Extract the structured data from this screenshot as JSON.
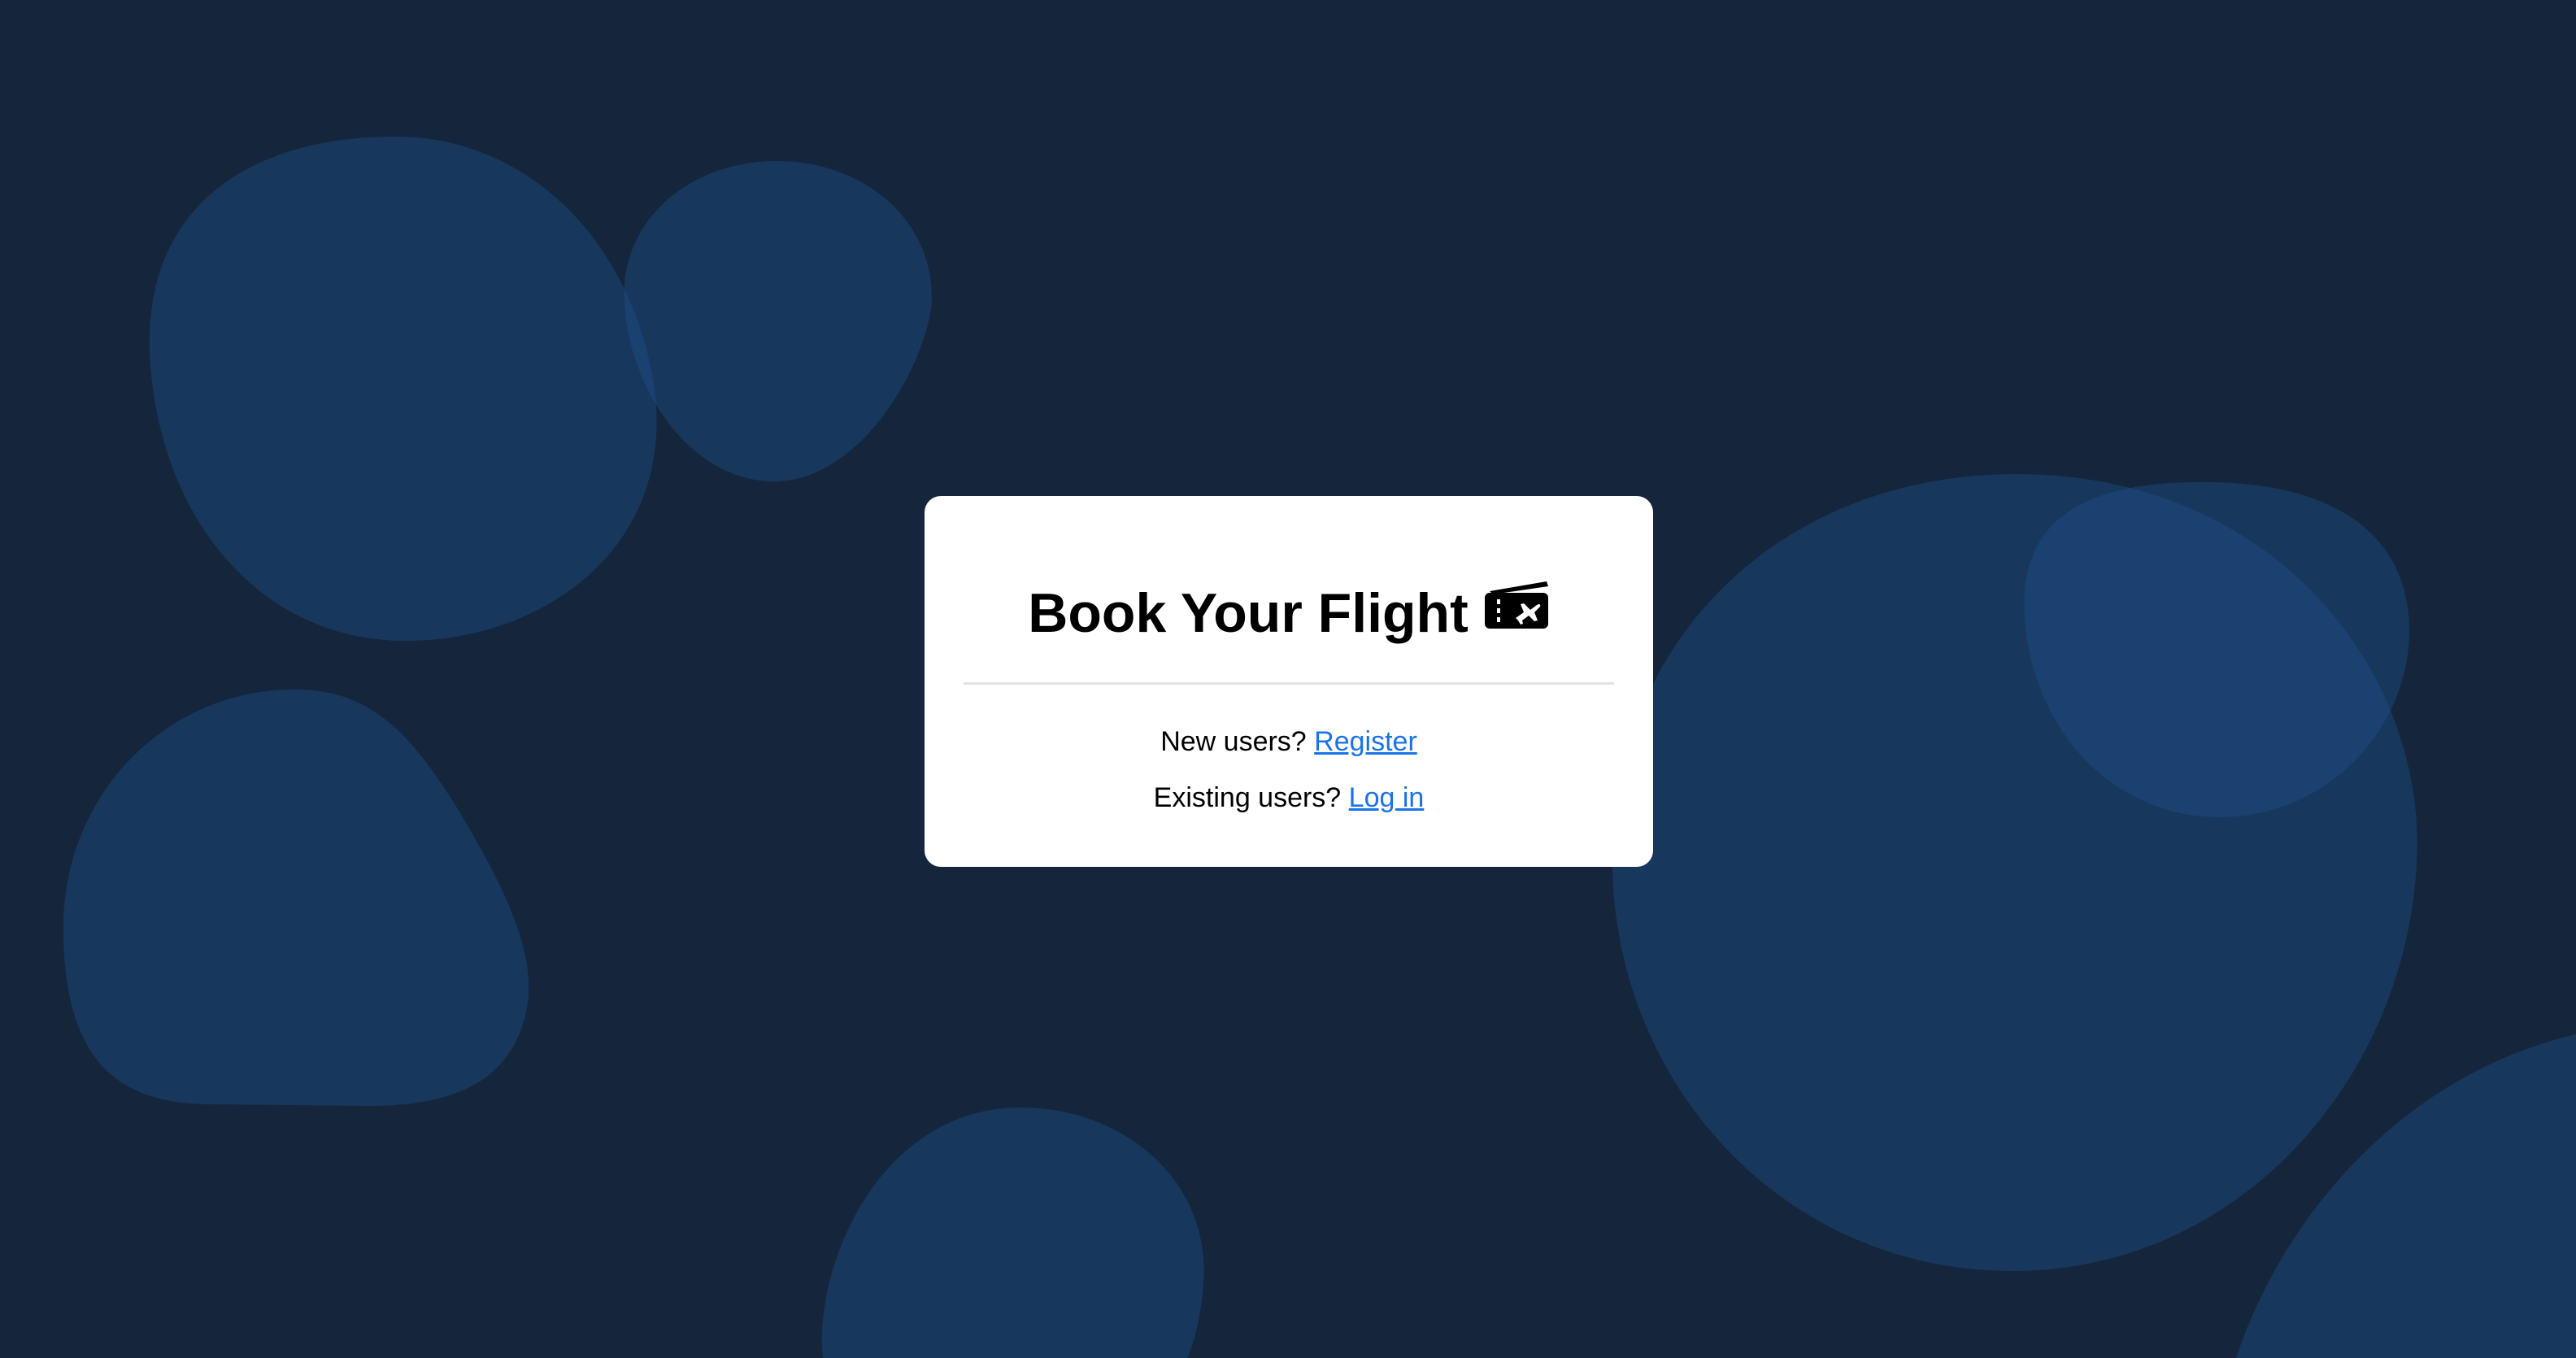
{
  "card": {
    "title": "Book Your Flight",
    "title_icon": "ticket-plane-icon",
    "new_users_text": "New users?",
    "register_link": "Register",
    "existing_users_text": "Existing users?",
    "login_link": "Log in"
  },
  "colors": {
    "background": "#15263c",
    "blob": "#1d4d85",
    "card": "#ffffff",
    "link": "#1a73e8",
    "divider": "#e3e3e3"
  }
}
